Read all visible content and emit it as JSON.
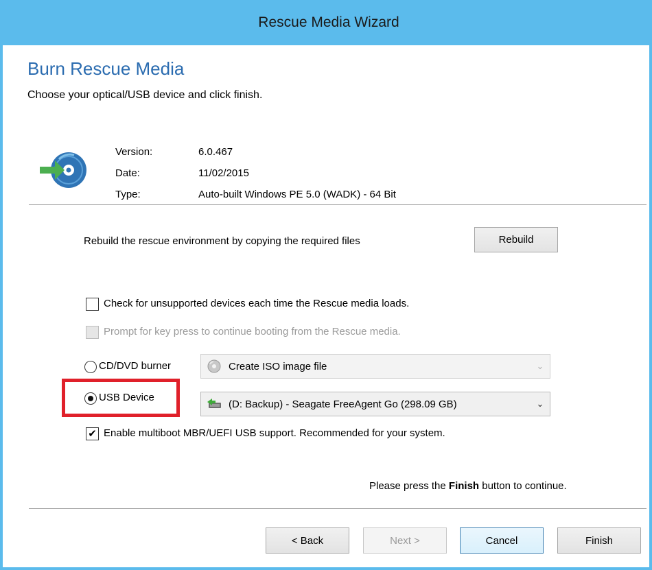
{
  "window": {
    "title": "Rescue Media Wizard"
  },
  "header": {
    "title": "Burn Rescue Media",
    "subtitle": "Choose your optical/USB device and click finish."
  },
  "info": {
    "version_label": "Version:",
    "version_value": "6.0.467",
    "date_label": "Date:",
    "date_value": "11/02/2015",
    "type_label": "Type:",
    "type_value": "Auto-built Windows PE 5.0 (WADK) - 64 Bit",
    "icon": "disc-arrow-icon"
  },
  "rebuild": {
    "text": "Rebuild the rescue environment by copying the required files",
    "button_label": "Rebuild"
  },
  "options": {
    "check_unsupported": {
      "label": "Check for unsupported devices each time the Rescue media loads.",
      "checked": false,
      "enabled": true
    },
    "prompt_keypress": {
      "label": "Prompt for key press to continue booting from the Rescue media.",
      "checked": false,
      "enabled": false
    },
    "multiboot": {
      "label": "Enable multiboot MBR/UEFI USB support. Recommended for your system.",
      "checked": true,
      "enabled": true,
      "check_glyph": "✔"
    }
  },
  "media": {
    "cd_dvd": {
      "label": "CD/DVD burner",
      "selected": false,
      "select_value": "Create ISO image file",
      "icon": "cd-icon",
      "enabled": false
    },
    "usb": {
      "label": "USB Device",
      "selected": true,
      "select_value": "(D: Backup) - Seagate FreeAgent Go (298.09 GB)",
      "icon": "usb-drive-icon",
      "enabled": true
    }
  },
  "finish_note": {
    "prefix": "Please press the ",
    "emphasis": "Finish",
    "suffix": " button to continue."
  },
  "footer": {
    "back_label": "< Back",
    "next_label": "Next >",
    "cancel_label": "Cancel",
    "finish_label": "Finish"
  },
  "colors": {
    "titlebar": "#5bbbec",
    "heading": "#2b6cb0",
    "highlight": "#e0202a"
  }
}
